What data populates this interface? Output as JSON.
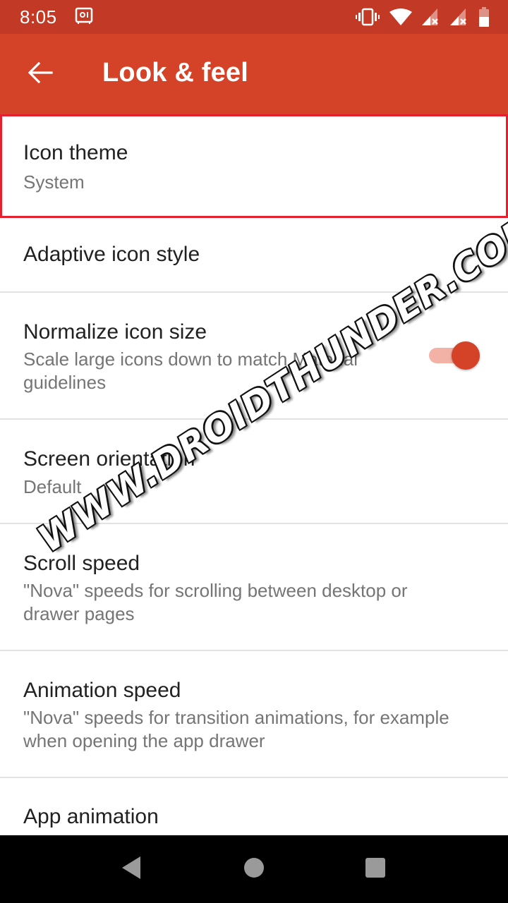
{
  "status_bar": {
    "time": "8:05",
    "left_icons": [
      "safe-vault-icon"
    ],
    "right_icons": [
      "vibrate-icon",
      "wifi-icon",
      "signal-no-service-icon",
      "signal-no-service-icon",
      "battery-low-icon"
    ]
  },
  "app_bar": {
    "title": "Look & feel",
    "back_icon": "arrow-back-icon"
  },
  "preferences": [
    {
      "title": "Icon theme",
      "summary": "System",
      "highlighted": true
    },
    {
      "title": "Adaptive icon style"
    },
    {
      "title": "Normalize icon size",
      "summary": "Scale large icons down to match Material guidelines",
      "toggle": {
        "on": true
      }
    },
    {
      "title": "Screen orientation",
      "summary": "Default"
    },
    {
      "title": "Scroll speed",
      "summary": "\"Nova\" speeds for scrolling between desktop or drawer pages"
    },
    {
      "title": "Animation speed",
      "summary": "\"Nova\" speeds for transition animations, for example when opening the app drawer"
    },
    {
      "title": "App animation"
    }
  ],
  "nav_bar": {
    "buttons": [
      "back-triangle-icon",
      "home-circle-icon",
      "recents-square-icon"
    ]
  },
  "watermark": "WWW.DROIDTHUNDER.COM",
  "colors": {
    "status_bar": "#c23a25",
    "app_bar": "#d44227",
    "accent": "#d44227",
    "highlight_border": "#e5202e",
    "toggle_track": "#f2b2a6"
  }
}
